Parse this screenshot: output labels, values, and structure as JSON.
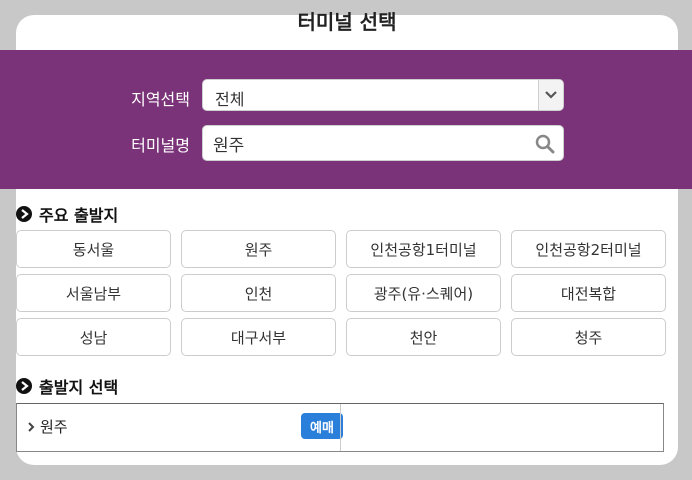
{
  "dialog": {
    "title": "터미널 선택"
  },
  "filters": {
    "region_label": "지역선택",
    "region_selected": "전체",
    "terminal_label": "터미널명",
    "terminal_value": "원주"
  },
  "major_departures": {
    "title": "주요 출발지",
    "items": [
      "동서울",
      "원주",
      "인천공항1터미널",
      "인천공항2터미널",
      "서울남부",
      "인천",
      "광주(유·스퀘어)",
      "대전복합",
      "성남",
      "대구서부",
      "천안",
      "청주"
    ]
  },
  "departure_select": {
    "title": "출발지 선택",
    "results": [
      {
        "name": "원주",
        "badge": "예매"
      }
    ]
  },
  "colors": {
    "band": "#7a3278",
    "badge": "#2a7fdb"
  }
}
